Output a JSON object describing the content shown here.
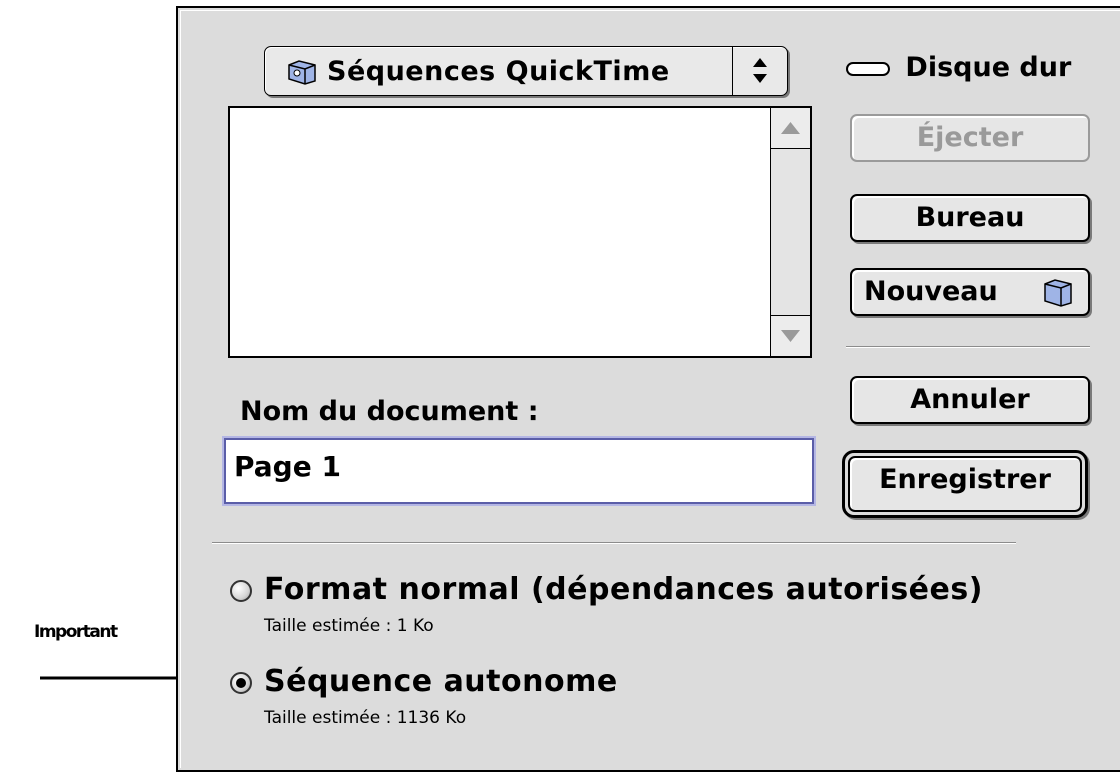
{
  "annotation": {
    "label": "Important"
  },
  "dialog": {
    "folder_popup": {
      "label": "Séquences QuickTime",
      "icon": "folder-icon"
    },
    "disk": {
      "label": "Disque dur",
      "icon": "disk-icon"
    },
    "file_list": {
      "items": []
    },
    "buttons": {
      "eject": "Éjecter",
      "desktop": "Bureau",
      "new_folder": "Nouveau",
      "cancel": "Annuler",
      "save": "Enregistrer"
    },
    "name_field": {
      "label": "Nom du document :",
      "value": "Page 1"
    },
    "options": [
      {
        "label": "Format normal (dépendances autorisées)",
        "size": "Taille estimée : 1 Ko",
        "selected": false
      },
      {
        "label": "Séquence autonome",
        "size": "Taille estimée : 1136 Ko",
        "selected": true
      }
    ]
  }
}
